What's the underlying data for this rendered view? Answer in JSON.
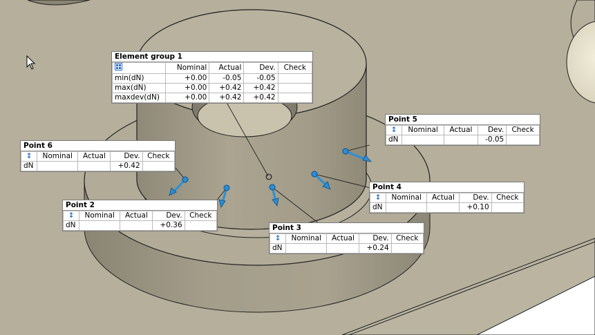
{
  "colors": {
    "background": "#b3ad9a",
    "surface_top": "#b8b29f",
    "wall_dark": "#8e8878",
    "wall_light": "#aaa491",
    "edge": "#1e1e1e",
    "vector": "#2a8fd6",
    "vector_dark": "#0d4f8a",
    "label_bg": "#ffffff"
  },
  "group": {
    "title": "Element group 1",
    "icon": "grid-icon",
    "headers": [
      "Nominal",
      "Actual",
      "Dev.",
      "Check"
    ],
    "rows": [
      {
        "name": "min(dN)",
        "nominal": "+0.00",
        "actual": "-0.05",
        "dev": "-0.05",
        "check": ""
      },
      {
        "name": "max(dN)",
        "nominal": "+0.00",
        "actual": "+0.42",
        "dev": "+0.42",
        "check": ""
      },
      {
        "name": "maxdev(dN)",
        "nominal": "+0.00",
        "actual": "+0.42",
        "dev": "+0.42",
        "check": ""
      }
    ]
  },
  "points": [
    {
      "title": "Point 5",
      "icon": "normal-arrow-icon",
      "headers": [
        "Nominal",
        "Actual",
        "Dev.",
        "Check"
      ],
      "row_label": "dN",
      "nominal": "",
      "actual": "",
      "dev": "-0.05",
      "check": ""
    },
    {
      "title": "Point 6",
      "icon": "normal-arrow-icon",
      "headers": [
        "Nominal",
        "Actual",
        "Dev.",
        "Check"
      ],
      "row_label": "dN",
      "nominal": "",
      "actual": "",
      "dev": "+0.42",
      "check": ""
    },
    {
      "title": "Point 4",
      "icon": "normal-arrow-icon",
      "headers": [
        "Nominal",
        "Actual",
        "Dev.",
        "Check"
      ],
      "row_label": "dN",
      "nominal": "",
      "actual": "",
      "dev": "+0.10",
      "check": ""
    },
    {
      "title": "Point 2",
      "icon": "normal-arrow-icon",
      "headers": [
        "Nominal",
        "Actual",
        "Dev.",
        "Check"
      ],
      "row_label": "dN",
      "nominal": "",
      "actual": "",
      "dev": "+0.36",
      "check": ""
    },
    {
      "title": "Point 3",
      "icon": "normal-arrow-icon",
      "headers": [
        "Nominal",
        "Actual",
        "Dev.",
        "Check"
      ],
      "row_label": "dN",
      "nominal": "",
      "actual": "",
      "dev": "+0.24",
      "check": ""
    }
  ]
}
